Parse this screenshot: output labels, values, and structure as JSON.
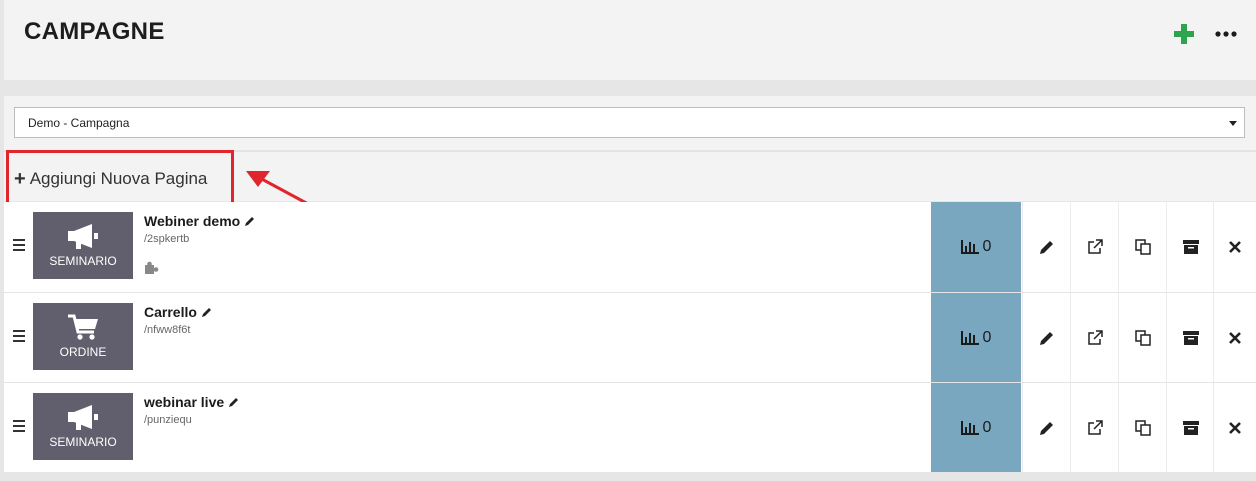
{
  "header": {
    "title": "CAMPAGNE",
    "add_icon": "plus-icon",
    "more_icon": "ellipsis-icon",
    "add_color": "#2ea44f"
  },
  "campaign_select": {
    "value": "Demo - Campagna"
  },
  "add_page": {
    "label": "Aggiungi Nuova Pagina"
  },
  "annotation": {
    "color": "#e0262c"
  },
  "pages": [
    {
      "name": "Webiner demo",
      "slug": "/2spkertb",
      "type": "SEMINARIO",
      "icon": "megaphone-icon",
      "stats": "0",
      "has_plugin": true
    },
    {
      "name": "Carrello",
      "slug": "/nfww8f6t",
      "type": "ORDINE",
      "icon": "cart-icon",
      "stats": "0",
      "has_plugin": false
    },
    {
      "name": "webinar live",
      "slug": "/punziequ",
      "type": "SEMINARIO",
      "icon": "megaphone-icon",
      "stats": "0",
      "has_plugin": false
    }
  ],
  "colors": {
    "thumb_bg": "#615f6d",
    "stats_bg": "#7aa7c0"
  }
}
